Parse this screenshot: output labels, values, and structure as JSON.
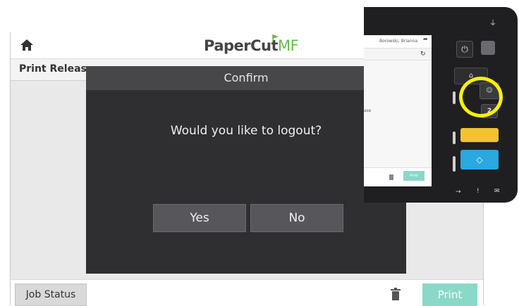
{
  "app": {
    "brand_main": "PaperCut",
    "brand_suffix": "MF",
    "section_title": "Print Releas",
    "job_status_label": "Job Status",
    "print_label": "Print"
  },
  "dialog": {
    "title": "Confirm",
    "message": "Would you like to logout?",
    "yes_label": "Yes",
    "no_label": "No"
  },
  "device_photo": {
    "user_name": "Borowski, Brianna",
    "mini_release_text": "ase",
    "mini_print_label": "Print",
    "button_two_label": "2"
  },
  "colors": {
    "accent_green": "#68b84f",
    "print_button": "#8ad8c7",
    "dialog_bg": "#2f2f31",
    "highlight": "#f7ef0a"
  },
  "icons": {
    "home": "home-icon",
    "trash": "trash-icon",
    "logout": "logout-icon",
    "refresh": "refresh-icon",
    "power": "power-icon",
    "user": "user-icon"
  }
}
